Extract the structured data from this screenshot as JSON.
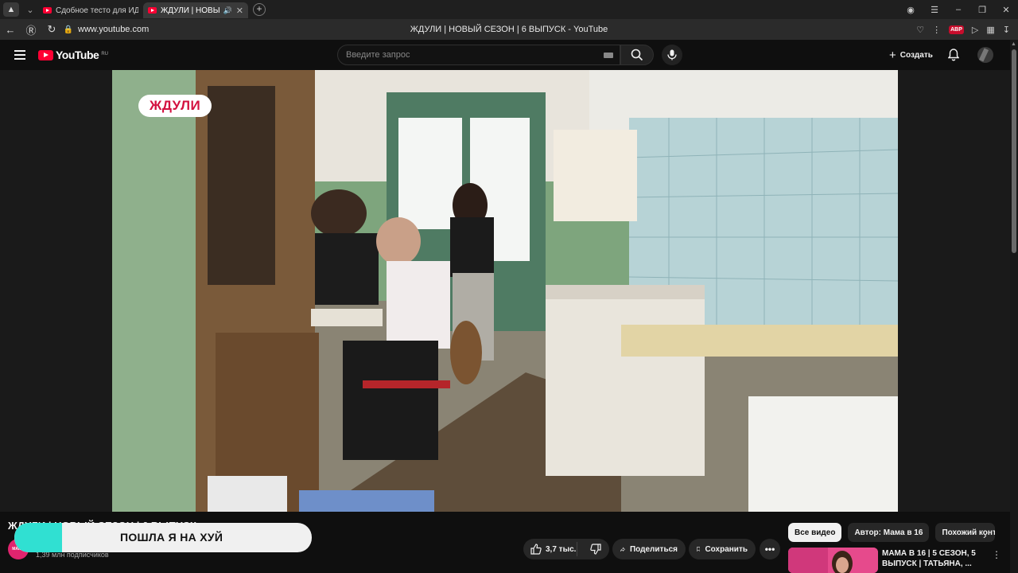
{
  "browser": {
    "tabs": [
      {
        "label": "Сдобное тесто для ИДЕА"
      },
      {
        "label": "ЖДУЛИ | НОВЫЙ С"
      }
    ],
    "url": "www.youtube.com",
    "page_title": "ЖДУЛИ | НОВЫЙ СЕЗОН | 6 ВЫПУСК - YouTube",
    "adblock_label": "ABP"
  },
  "youtube": {
    "logo_text": "YouTube",
    "region": "RU",
    "search_placeholder": "Введите запрос",
    "create_label": "Создать"
  },
  "video": {
    "badge": "ЖДУЛИ",
    "title": "ЖДУЛИ | НОВЫЙ СЕЗОН | 6 ВЫПУСК",
    "channel_avatar_text": "МАМА",
    "subscribers": "1,39 млн подписчиков",
    "likes": "3,7 тыс.",
    "share_label": "Поделиться",
    "save_label": "Сохранить"
  },
  "overlay": {
    "text": "ПОШЛА Я НА ХУЙ",
    "progress": 0.16
  },
  "sidebar": {
    "chips": [
      {
        "label": "Все видео",
        "active": true
      },
      {
        "label": "Автор: Мама в 16",
        "active": false
      },
      {
        "label": "Похожий конт",
        "active": false
      }
    ],
    "recommendation": {
      "title": "МАМА В 16 | 5 СЕЗОН, 5 ВЫПУСК | ТАТЬЯНА, ..."
    }
  },
  "colors": {
    "accent_red": "#ff0033",
    "badge_text": "#d3113f",
    "overlay_fill": "#30e0d2"
  }
}
